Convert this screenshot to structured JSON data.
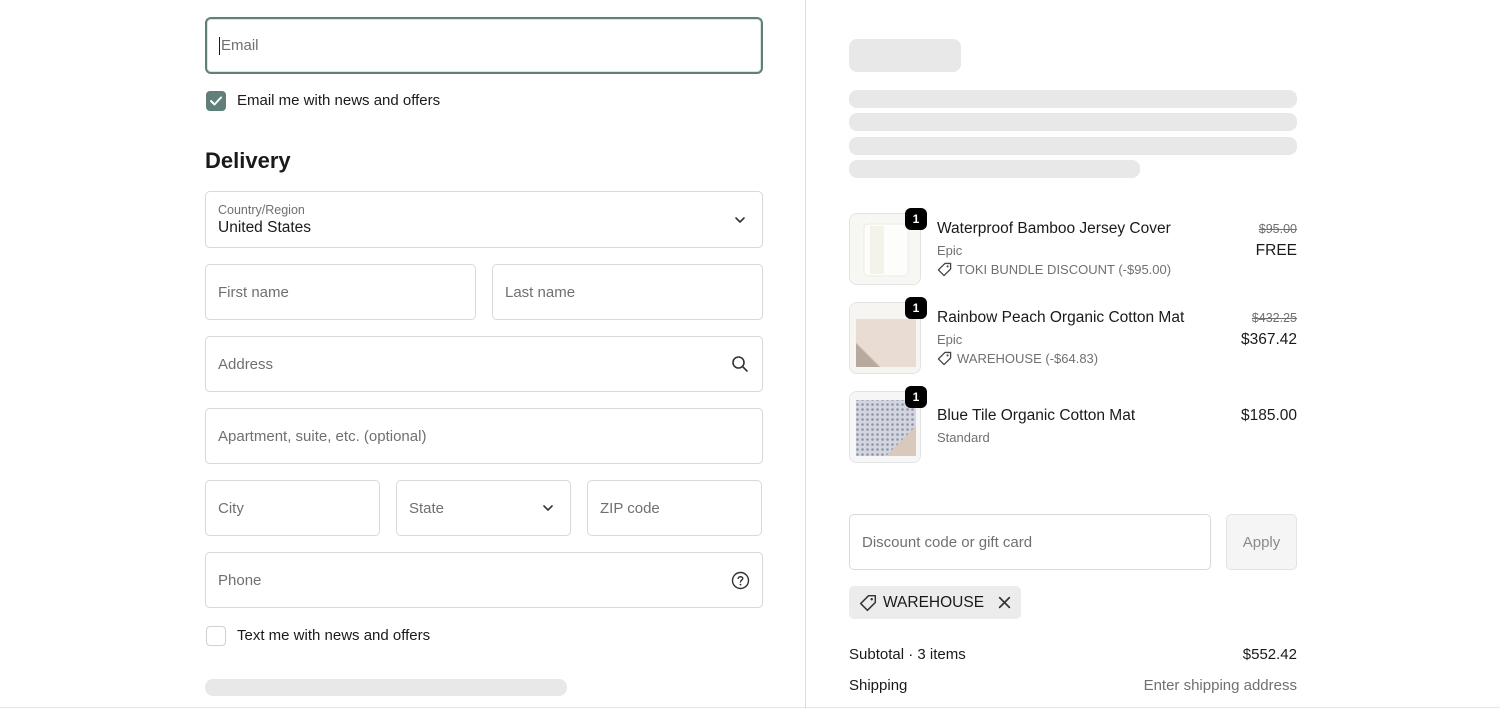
{
  "contact": {
    "email_placeholder": "Email",
    "marketing_email_label": "Email me with news and offers",
    "marketing_email_checked": true
  },
  "delivery": {
    "title": "Delivery",
    "country_label": "Country/Region",
    "country_value": "United States",
    "first_name_placeholder": "First name",
    "last_name_placeholder": "Last name",
    "address_placeholder": "Address",
    "apartment_placeholder": "Apartment, suite, etc. (optional)",
    "city_placeholder": "City",
    "state_placeholder": "State",
    "zip_placeholder": "ZIP code",
    "phone_placeholder": "Phone",
    "sms_label": "Text me with news and offers",
    "sms_checked": false
  },
  "cart": {
    "items": [
      {
        "quantity": "1",
        "name": "Waterproof Bamboo Jersey Cover",
        "variant": "Epic",
        "discount": "TOKI BUNDLE DISCOUNT (-$95.00)",
        "original_price": "$95.00",
        "price": "FREE"
      },
      {
        "quantity": "1",
        "name": "Rainbow Peach Organic Cotton Mat",
        "variant": "Epic",
        "discount": "WAREHOUSE (-$64.83)",
        "original_price": "$432.25",
        "price": "$367.42"
      },
      {
        "quantity": "1",
        "name": "Blue Tile Organic Cotton Mat",
        "variant": "Standard",
        "price": "$185.00"
      }
    ]
  },
  "discount": {
    "placeholder": "Discount code or gift card",
    "apply_label": "Apply",
    "applied_code": "WAREHOUSE"
  },
  "summary": {
    "subtotal_label": "Subtotal · 3 items",
    "subtotal_value": "$552.42",
    "shipping_label": "Shipping",
    "shipping_value": "Enter shipping address"
  },
  "colors": {
    "accent": "#5f7f78",
    "skeleton": "#e8e8e8",
    "muted_text": "#707070"
  },
  "icons": [
    "check-icon",
    "chevron-down-icon",
    "search-icon",
    "help-circle-icon",
    "tag-icon",
    "close-icon"
  ]
}
